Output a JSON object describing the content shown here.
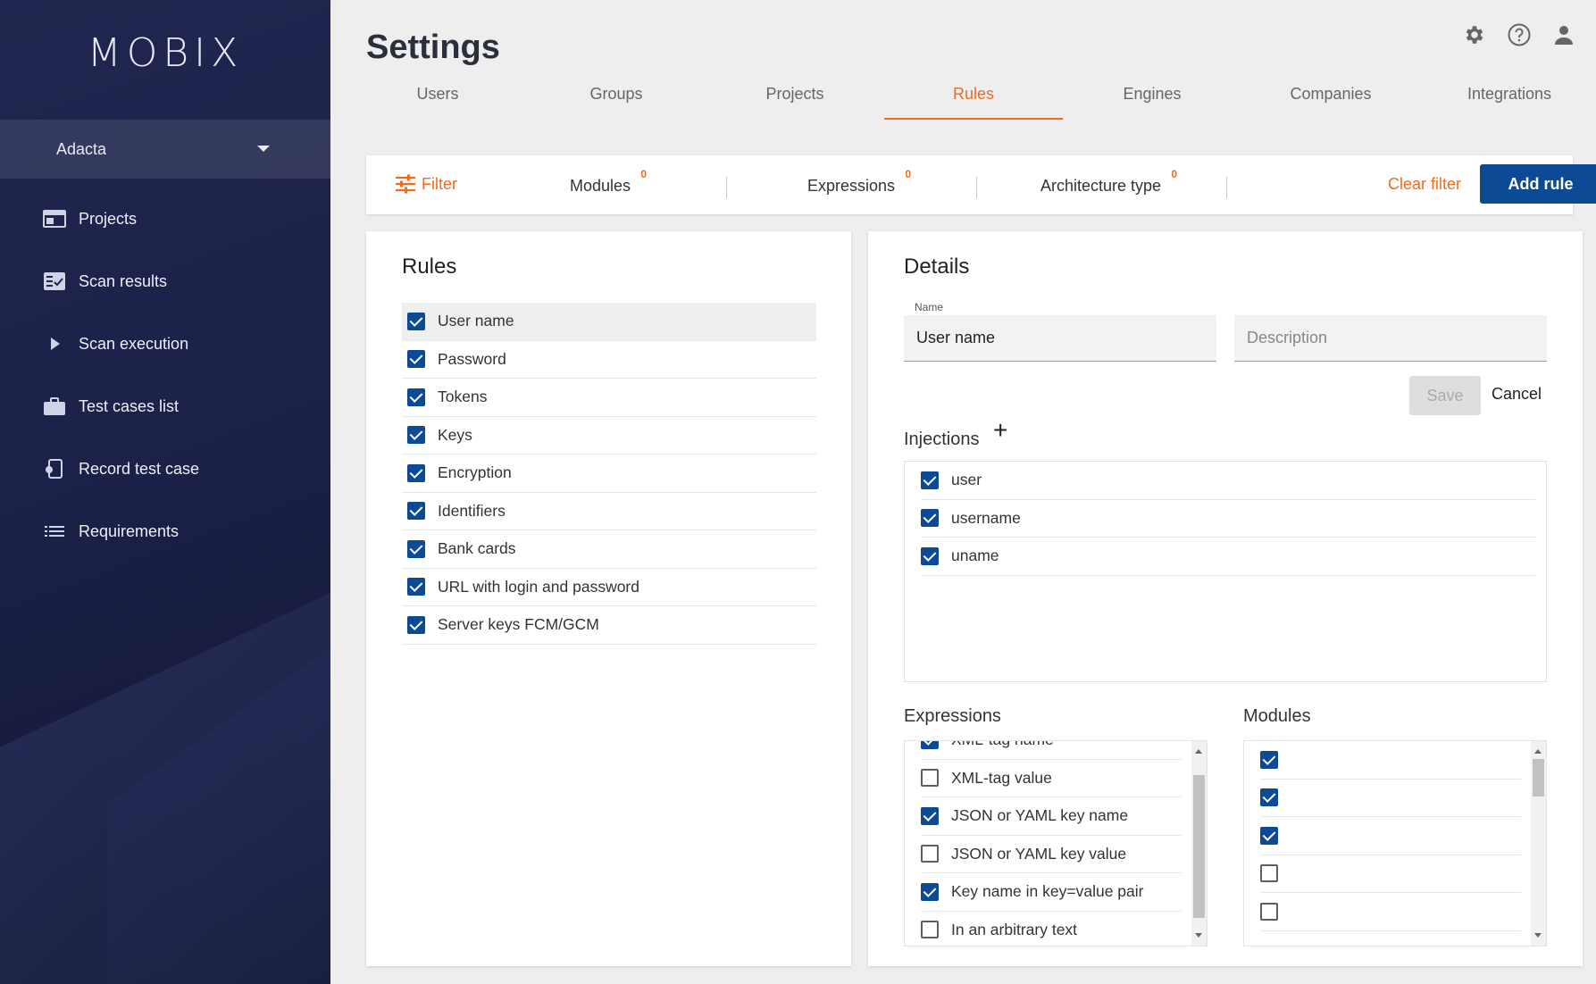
{
  "app": {
    "logo": "MOBIX"
  },
  "sidebar": {
    "company": "Adacta",
    "items": [
      {
        "label": "Projects",
        "icon": "projects-icon"
      },
      {
        "label": "Scan results",
        "icon": "scan-results-icon"
      },
      {
        "label": "Scan execution",
        "icon": "play-icon"
      },
      {
        "label": "Test cases list",
        "icon": "briefcase-icon"
      },
      {
        "label": "Record test case",
        "icon": "record-device-icon"
      },
      {
        "label": "Requirements",
        "icon": "list-icon"
      }
    ]
  },
  "header": {
    "title": "Settings",
    "icons": [
      "gear-icon",
      "help-icon",
      "user-icon"
    ]
  },
  "tabs": [
    {
      "label": "Users"
    },
    {
      "label": "Groups"
    },
    {
      "label": "Projects"
    },
    {
      "label": "Rules",
      "active": true
    },
    {
      "label": "Engines"
    },
    {
      "label": "Companies"
    },
    {
      "label": "Integrations"
    }
  ],
  "filter": {
    "filter_label": "Filter",
    "chips": [
      {
        "label": "Modules",
        "count": "0"
      },
      {
        "label": "Expressions",
        "count": "0"
      },
      {
        "label": "Architecture type",
        "count": "0"
      }
    ],
    "clear_label": "Clear filter",
    "add_label": "Add rule"
  },
  "rules": {
    "title": "Rules",
    "items": [
      {
        "label": "User name",
        "checked": true,
        "selected": true
      },
      {
        "label": "Password",
        "checked": true
      },
      {
        "label": "Tokens",
        "checked": true
      },
      {
        "label": "Keys",
        "checked": true
      },
      {
        "label": "Encryption",
        "checked": true
      },
      {
        "label": "Identifiers",
        "checked": true
      },
      {
        "label": "Bank cards",
        "checked": true
      },
      {
        "label": "URL with login and password",
        "checked": true
      },
      {
        "label": "Server keys FCM/GCM",
        "checked": true
      }
    ]
  },
  "details": {
    "title": "Details",
    "name_label": "Name",
    "name_value": "User name",
    "description_placeholder": "Description",
    "save_label": "Save",
    "cancel_label": "Cancel",
    "injections_title": "Injections",
    "injections": [
      {
        "label": "user",
        "checked": true
      },
      {
        "label": "username",
        "checked": true
      },
      {
        "label": "uname",
        "checked": true
      }
    ],
    "expressions_title": "Expressions",
    "expressions": [
      {
        "label": "XML-tag name",
        "checked": true
      },
      {
        "label": "XML-tag value",
        "checked": false
      },
      {
        "label": "JSON or YAML key name",
        "checked": true
      },
      {
        "label": "JSON or YAML key value",
        "checked": false
      },
      {
        "label": "Key name in key=value pair",
        "checked": true
      },
      {
        "label": "In an arbitrary text",
        "checked": false
      }
    ],
    "modules_title": "Modules",
    "modules": [
      {
        "checked": true
      },
      {
        "checked": true
      },
      {
        "checked": true
      },
      {
        "checked": false
      },
      {
        "checked": false
      }
    ]
  },
  "colors": {
    "accent": "#f26a1b",
    "primary": "#0d4a96",
    "sidebar": "#1b2148"
  }
}
